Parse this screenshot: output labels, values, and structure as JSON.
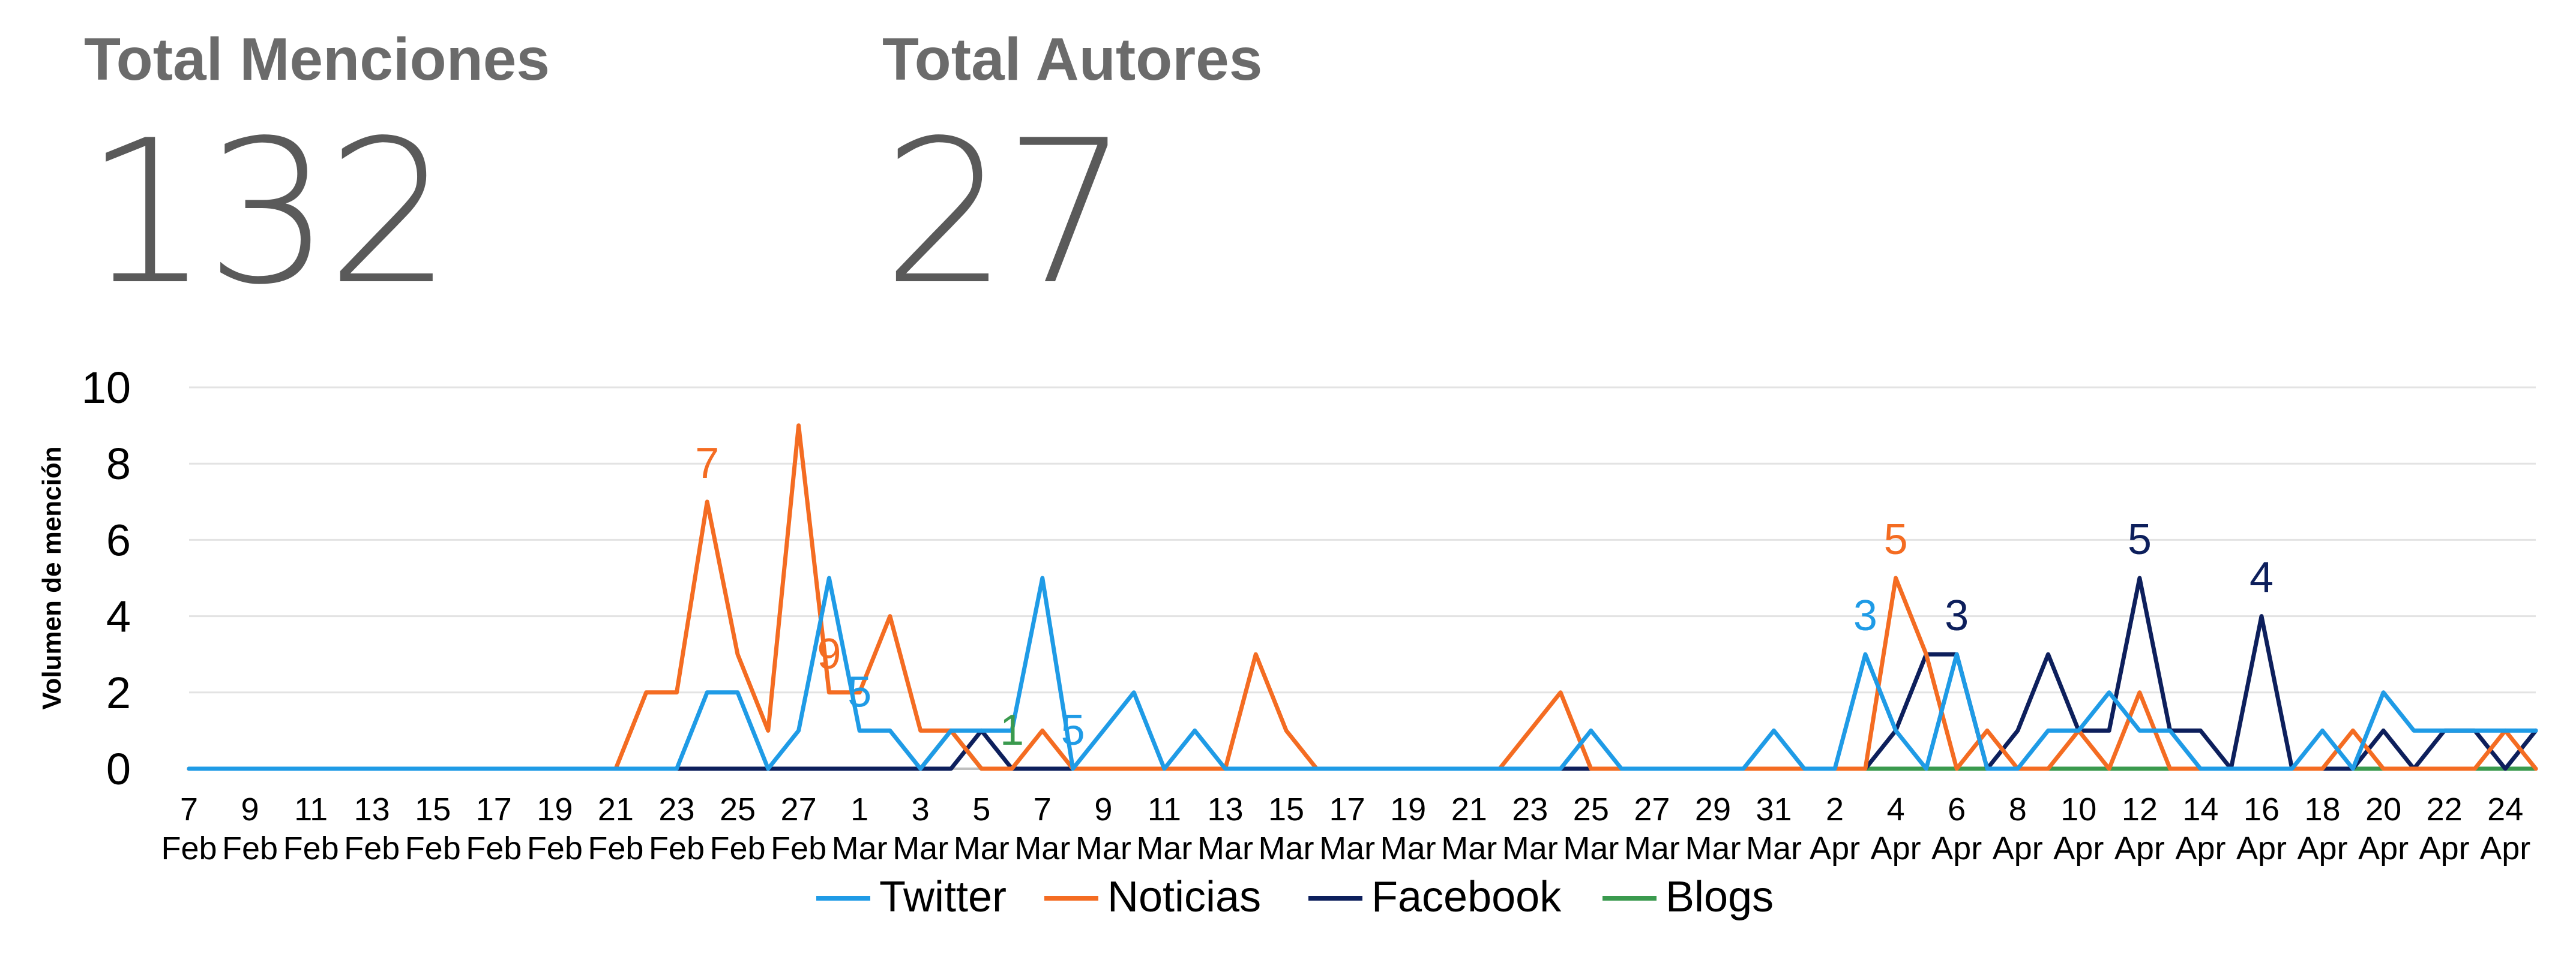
{
  "kpis": {
    "mentions_label": "Total Menciones",
    "mentions_value": "132",
    "authors_label": "Total Autores",
    "authors_value": "27"
  },
  "chart_data": {
    "type": "line",
    "ylabel": "Volumen de mención",
    "ylim": [
      0,
      10
    ],
    "yticks": [
      0,
      2,
      4,
      6,
      8,
      10
    ],
    "grid": true,
    "legend_position": "bottom",
    "x": [
      "7 Feb",
      "8 Feb",
      "9 Feb",
      "10 Feb",
      "11 Feb",
      "12 Feb",
      "13 Feb",
      "14 Feb",
      "15 Feb",
      "16 Feb",
      "17 Feb",
      "18 Feb",
      "19 Feb",
      "20 Feb",
      "21 Feb",
      "22 Feb",
      "23 Feb",
      "24 Feb",
      "25 Feb",
      "26 Feb",
      "27 Feb",
      "28 Feb",
      "1 Mar",
      "2 Mar",
      "3 Mar",
      "4 Mar",
      "5 Mar",
      "6 Mar",
      "7 Mar",
      "8 Mar",
      "9 Mar",
      "10 Mar",
      "11 Mar",
      "12 Mar",
      "13 Mar",
      "14 Mar",
      "15 Mar",
      "16 Mar",
      "17 Mar",
      "18 Mar",
      "19 Mar",
      "20 Mar",
      "21 Mar",
      "22 Mar",
      "23 Mar",
      "24 Mar",
      "25 Mar",
      "26 Mar",
      "27 Mar",
      "28 Mar",
      "29 Mar",
      "30 Mar",
      "31 Mar",
      "1 Apr",
      "2 Apr",
      "3 Apr",
      "4 Apr",
      "5 Apr",
      "6 Apr",
      "7 Apr",
      "8 Apr",
      "9 Apr",
      "10 Apr",
      "11 Apr",
      "12 Apr",
      "13 Apr",
      "14 Apr",
      "15 Apr",
      "16 Apr",
      "17 Apr",
      "18 Apr",
      "19 Apr",
      "20 Apr",
      "21 Apr",
      "22 Apr",
      "23 Apr",
      "24 Apr",
      "25 Apr"
    ],
    "tick_labels": [
      {
        "day": "7",
        "month": "Feb"
      },
      {
        "day": "9",
        "month": "Feb"
      },
      {
        "day": "11",
        "month": "Feb"
      },
      {
        "day": "13",
        "month": "Feb"
      },
      {
        "day": "15",
        "month": "Feb"
      },
      {
        "day": "17",
        "month": "Feb"
      },
      {
        "day": "19",
        "month": "Feb"
      },
      {
        "day": "21",
        "month": "Feb"
      },
      {
        "day": "23",
        "month": "Feb"
      },
      {
        "day": "25",
        "month": "Feb"
      },
      {
        "day": "27",
        "month": "Feb"
      },
      {
        "day": "1",
        "month": "Mar"
      },
      {
        "day": "3",
        "month": "Mar"
      },
      {
        "day": "5",
        "month": "Mar"
      },
      {
        "day": "7",
        "month": "Mar"
      },
      {
        "day": "9",
        "month": "Mar"
      },
      {
        "day": "11",
        "month": "Mar"
      },
      {
        "day": "13",
        "month": "Mar"
      },
      {
        "day": "15",
        "month": "Mar"
      },
      {
        "day": "17",
        "month": "Mar"
      },
      {
        "day": "19",
        "month": "Mar"
      },
      {
        "day": "21",
        "month": "Mar"
      },
      {
        "day": "23",
        "month": "Mar"
      },
      {
        "day": "25",
        "month": "Mar"
      },
      {
        "day": "27",
        "month": "Mar"
      },
      {
        "day": "29",
        "month": "Mar"
      },
      {
        "day": "31",
        "month": "Mar"
      },
      {
        "day": "2",
        "month": "Apr"
      },
      {
        "day": "4",
        "month": "Apr"
      },
      {
        "day": "6",
        "month": "Apr"
      },
      {
        "day": "8",
        "month": "Apr"
      },
      {
        "day": "10",
        "month": "Apr"
      },
      {
        "day": "12",
        "month": "Apr"
      },
      {
        "day": "14",
        "month": "Apr"
      },
      {
        "day": "16",
        "month": "Apr"
      },
      {
        "day": "18",
        "month": "Apr"
      },
      {
        "day": "20",
        "month": "Apr"
      },
      {
        "day": "22",
        "month": "Apr"
      },
      {
        "day": "24",
        "month": "Apr"
      }
    ],
    "series": [
      {
        "name": "Twitter",
        "color": "#1f9be6",
        "values": [
          0,
          0,
          0,
          0,
          0,
          0,
          0,
          0,
          0,
          0,
          0,
          0,
          0,
          0,
          0,
          0,
          0,
          2,
          2,
          0,
          1,
          5,
          1,
          1,
          0,
          1,
          1,
          1,
          5,
          0,
          1,
          2,
          0,
          1,
          0,
          0,
          0,
          0,
          0,
          0,
          0,
          0,
          0,
          0,
          0,
          0,
          1,
          0,
          0,
          0,
          0,
          0,
          1,
          0,
          0,
          3,
          1,
          0,
          3,
          0,
          0,
          1,
          1,
          2,
          1,
          1,
          0,
          0,
          0,
          0,
          1,
          0,
          2,
          1,
          1,
          1,
          1,
          1
        ]
      },
      {
        "name": "Noticias",
        "color": "#f46c22",
        "values": [
          0,
          0,
          0,
          0,
          0,
          0,
          0,
          0,
          0,
          0,
          0,
          0,
          0,
          0,
          0,
          2,
          2,
          7,
          3,
          1,
          9,
          2,
          2,
          4,
          1,
          1,
          0,
          0,
          1,
          0,
          0,
          0,
          0,
          0,
          0,
          3,
          1,
          0,
          0,
          0,
          0,
          0,
          0,
          0,
          1,
          2,
          0,
          0,
          0,
          0,
          0,
          0,
          0,
          0,
          0,
          0,
          5,
          3,
          0,
          1,
          0,
          0,
          1,
          0,
          2,
          0,
          0,
          0,
          0,
          0,
          0,
          1,
          0,
          0,
          0,
          0,
          1,
          0
        ]
      },
      {
        "name": "Facebook",
        "color": "#0d1f5c",
        "values": [
          0,
          0,
          0,
          0,
          0,
          0,
          0,
          0,
          0,
          0,
          0,
          0,
          0,
          0,
          0,
          0,
          0,
          0,
          0,
          0,
          0,
          0,
          0,
          0,
          0,
          0,
          1,
          0,
          0,
          0,
          0,
          0,
          0,
          0,
          0,
          0,
          0,
          0,
          0,
          0,
          0,
          0,
          0,
          0,
          0,
          0,
          0,
          0,
          0,
          0,
          0,
          0,
          0,
          0,
          0,
          0,
          1,
          3,
          3,
          0,
          1,
          3,
          1,
          1,
          5,
          1,
          1,
          0,
          4,
          0,
          0,
          0,
          1,
          0,
          1,
          1,
          0,
          1
        ]
      },
      {
        "name": "Blogs",
        "color": "#3a9a4e",
        "values": [
          0,
          0,
          0,
          0,
          0,
          0,
          0,
          0,
          0,
          0,
          0,
          0,
          0,
          0,
          0,
          0,
          0,
          0,
          0,
          0,
          0,
          0,
          0,
          0,
          0,
          1,
          0,
          0,
          0,
          0,
          0,
          0,
          0,
          0,
          0,
          0,
          0,
          0,
          0,
          0,
          0,
          0,
          0,
          0,
          0,
          0,
          0,
          0,
          0,
          0,
          0,
          0,
          0,
          0,
          0,
          0,
          0,
          0,
          0,
          0,
          0,
          0,
          0,
          0,
          0,
          0,
          0,
          0,
          0,
          0,
          0,
          0,
          0,
          0,
          0,
          0,
          0,
          0
        ]
      }
    ],
    "annotations": [
      {
        "series": "Noticias",
        "x": "24 Feb",
        "label": "7"
      },
      {
        "series": "Noticias",
        "x": "28 Feb",
        "label": "9"
      },
      {
        "series": "Twitter",
        "x": "1 Mar",
        "label": "5"
      },
      {
        "series": "Blogs",
        "x": "6 Mar",
        "label": "1"
      },
      {
        "series": "Twitter",
        "x": "8 Mar",
        "label": "5"
      },
      {
        "series": "Twitter",
        "x": "3 Apr",
        "label": "3"
      },
      {
        "series": "Noticias",
        "x": "4 Apr",
        "label": "5"
      },
      {
        "series": "Facebook",
        "x": "6 Apr",
        "label": "3"
      },
      {
        "series": "Facebook",
        "x": "12 Apr",
        "label": "5"
      },
      {
        "series": "Facebook",
        "x": "16 Apr",
        "label": "4"
      }
    ]
  }
}
